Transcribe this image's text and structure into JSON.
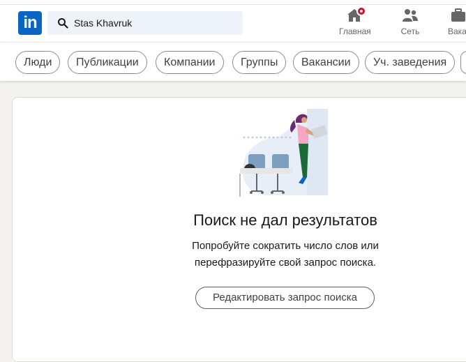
{
  "header": {
    "logo_text": "in",
    "search": {
      "value": "Stas Khavruk",
      "icon": "search-icon"
    },
    "nav": [
      {
        "label": "Главная",
        "icon": "home-icon",
        "badge": true
      },
      {
        "label": "Сеть",
        "icon": "network-icon"
      },
      {
        "label": "Вакансии",
        "icon": "jobs-icon"
      }
    ]
  },
  "filters": [
    "Люди",
    "Публикации",
    "Компании",
    "Группы",
    "Вакансии",
    "Уч. заведения"
  ],
  "empty_state": {
    "title": "Поиск не дал результатов",
    "subtitle_line1": "Попробуйте сократить число слов или",
    "subtitle_line2": "перефразируйте свой запрос поиска.",
    "button": "Редактировать запрос поиска"
  },
  "colors": {
    "brand": "#0a66c2",
    "badge": "#cb112d",
    "search_bg": "#edf3f8",
    "page_bg": "#f4f2ee"
  }
}
